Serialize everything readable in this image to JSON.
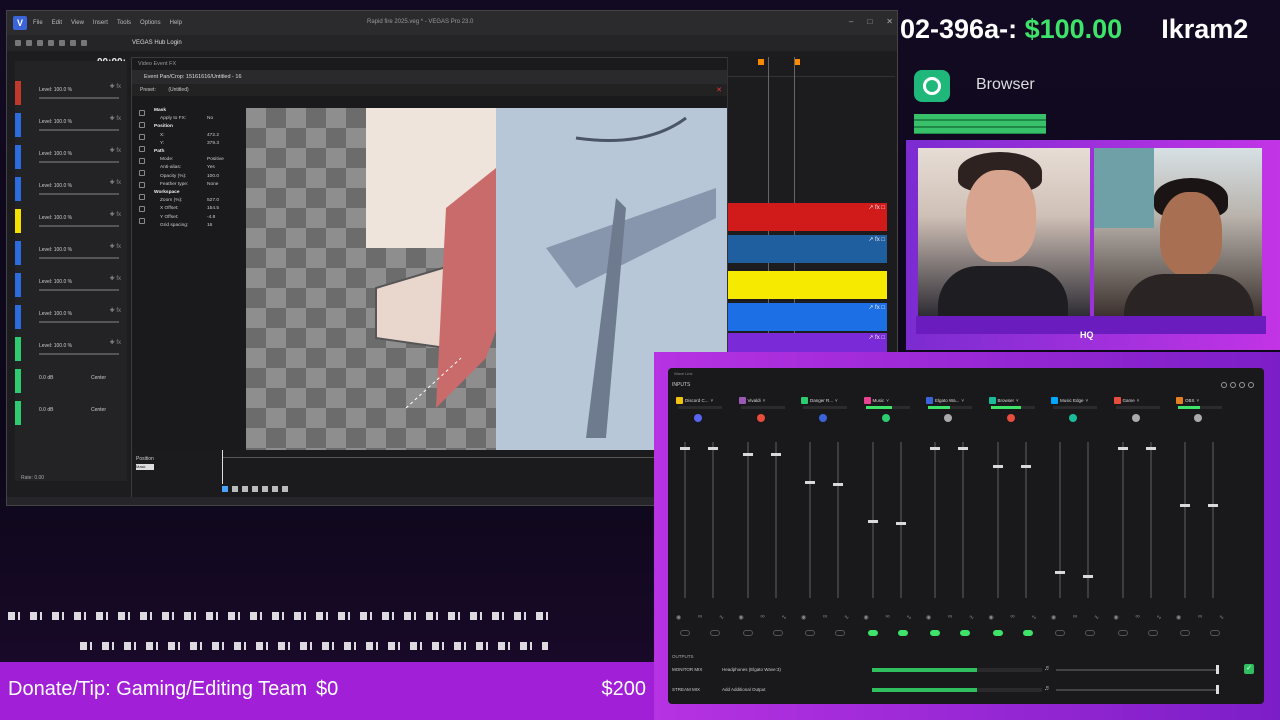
{
  "vegas": {
    "window_title": "Rapid fire 2025.veg * - VEGAS Pro 23.0",
    "menu": [
      "File",
      "Edit",
      "View",
      "Insert",
      "Tools",
      "Options",
      "Help"
    ],
    "hub_login": "VEGAS Hub Login",
    "timecode": "00:00:",
    "video_event_fx": "Video Event FX",
    "track_levels": [
      "Level: 100.0 %",
      "Level: 100.0 %",
      "Level: 100.0 %",
      "Level: 100.0 %",
      "Level: 100.0 %",
      "Level: 100.0 %",
      "Level: 100.0 %",
      "Level: 100.0 %",
      "Level: 100.0 %"
    ],
    "audio_tracks": [
      {
        "db": "0.0 dB",
        "pan": "Center"
      },
      {
        "db": "0.0 dB",
        "pan": "Center"
      }
    ],
    "rate": "Rate: 0.00",
    "pancrop": {
      "title": "Event Pan/Crop: 15161616/Untitled - 16",
      "preset_label": "Preset:",
      "preset_value": "(Untitled)",
      "props": [
        {
          "k": "Mask",
          "v": "",
          "section": true
        },
        {
          "k": "Apply to FX:",
          "v": "No"
        },
        {
          "k": "Position",
          "v": "",
          "section": true
        },
        {
          "k": "X:",
          "v": "472.2"
        },
        {
          "k": "Y:",
          "v": "379.3"
        },
        {
          "k": "Path",
          "v": "",
          "section": true
        },
        {
          "k": "Mode:",
          "v": "Positive"
        },
        {
          "k": "Anti-alias:",
          "v": "Yes"
        },
        {
          "k": "Opacity (%):",
          "v": "100.0"
        },
        {
          "k": "Feather type:",
          "v": "None"
        },
        {
          "k": "Workspace",
          "v": "",
          "section": true
        },
        {
          "k": "Zoom (%):",
          "v": "527.0"
        },
        {
          "k": "X Offset:",
          "v": "154.5"
        },
        {
          "k": "Y Offset:",
          "v": "-4.8"
        },
        {
          "k": "Grid spacing:",
          "v": "16"
        }
      ],
      "timeline_label": "Position",
      "timeline_sub": "Mask"
    }
  },
  "ticker": {
    "name": "02-396a-:",
    "amount": "$100.00",
    "next_name": "Ikram2"
  },
  "browser_source": {
    "label": "Browser"
  },
  "cams": {
    "logo": "HQ"
  },
  "mixer": {
    "top_label": "Wave Link",
    "inputs_label": "INPUTS",
    "outputs_label": "OUTPUTS",
    "channels": [
      {
        "name": "Discord C...",
        "color": "#f1c40f",
        "meter": 0,
        "icon_color": "#5865f2",
        "mix": false
      },
      {
        "name": "Vivaldi",
        "color": "#9b59b6",
        "meter": 0,
        "icon_color": "#e74c3c",
        "mix": false
      },
      {
        "name": "Danger R...",
        "color": "#2ecc71",
        "meter": 0,
        "icon_color": "#3a64d8",
        "mix": false
      },
      {
        "name": "Music",
        "color": "#e84393",
        "meter": 0.6,
        "icon_color": "#2ecc71",
        "mix": true
      },
      {
        "name": "Elgato Wa...",
        "color": "#3a64d8",
        "meter": 0.5,
        "icon_color": "#aaaaaa",
        "mix": true
      },
      {
        "name": "Browser",
        "color": "#1abc9c",
        "meter": 0.7,
        "icon_color": "#e74c3c",
        "mix": true
      },
      {
        "name": "Music Edge",
        "color": "#00a8ff",
        "meter": 0,
        "icon_color": "#1abc9c",
        "mix": false
      },
      {
        "name": "Game",
        "color": "#e74c3c",
        "meter": 0,
        "icon_color": "#aaaaaa",
        "mix": false
      },
      {
        "name": "OBS",
        "color": "#e67e22",
        "meter": 0.5,
        "icon_color": "#aaaaaa",
        "mix": false
      }
    ],
    "fader_levels": [
      [
        0.97,
        0.97
      ],
      [
        0.93,
        0.93
      ],
      [
        0.75,
        0.74
      ],
      [
        0.5,
        0.49
      ],
      [
        0.97,
        0.97
      ],
      [
        0.85,
        0.85
      ],
      [
        0.17,
        0.15
      ],
      [
        0.97,
        0.97
      ],
      [
        0.6,
        0.6
      ]
    ],
    "outputs": [
      {
        "label": "MONITOR MIX",
        "device": "Headphones (Elgato Wave:3)",
        "level": 0.62,
        "volume": 1.0
      },
      {
        "label": "STREAM MIX",
        "device": "Add Additional Output",
        "level": 0.62,
        "volume": 1.0
      }
    ]
  },
  "donate": {
    "label": "Donate/Tip: Gaming/Editing Team",
    "current": "$0",
    "goal": "$200"
  }
}
